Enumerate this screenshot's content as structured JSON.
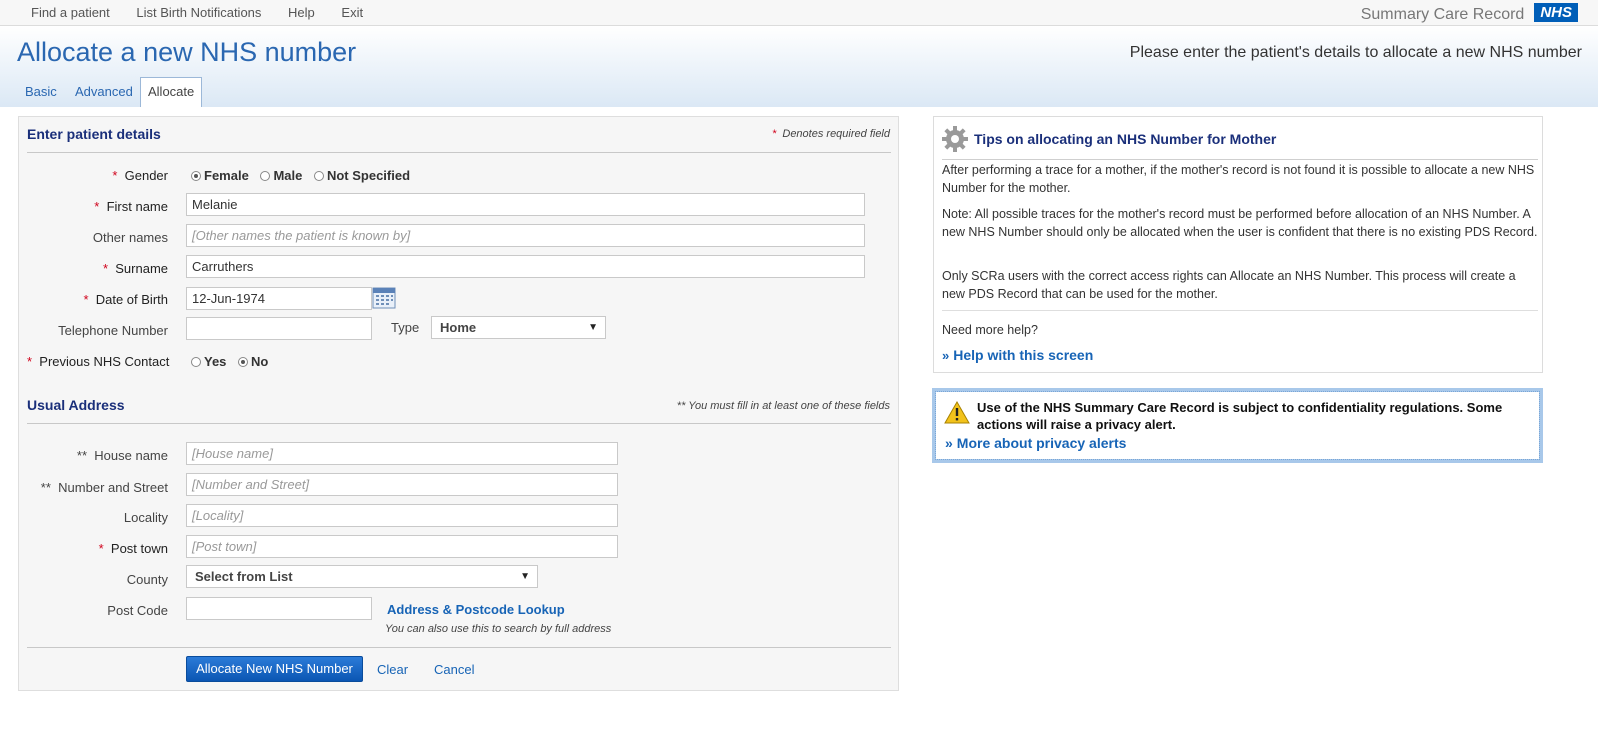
{
  "topnav": {
    "items": [
      "Find a patient",
      "List Birth Notifications",
      "Help",
      "Exit"
    ],
    "brand": "Summary Care Record",
    "logo": "NHS"
  },
  "header": {
    "title": "Allocate a new NHS number",
    "subtitle": "Please enter the patient's details to allocate a new NHS number",
    "tabs": [
      "Basic",
      "Advanced",
      "Allocate"
    ],
    "active_tab": "Allocate"
  },
  "form": {
    "section_title": "Enter patient details",
    "required_note": "Denotes required field",
    "required_mark": "*",
    "gender": {
      "label": "Gender",
      "options": [
        "Female",
        "Male",
        "Not Specified"
      ],
      "selected": "Female"
    },
    "first_name": {
      "label": "First name",
      "value": "Melanie"
    },
    "other_names": {
      "label": "Other names",
      "placeholder": "[Other names the patient is known by]"
    },
    "surname": {
      "label": "Surname",
      "value": "Carruthers"
    },
    "dob": {
      "label": "Date of Birth",
      "value": "12-Jun-1974"
    },
    "telephone": {
      "label": "Telephone Number",
      "value": "",
      "type_label": "Type",
      "type_value": "Home"
    },
    "prev_contact": {
      "label": "Previous NHS Contact",
      "options": [
        "Yes",
        "No"
      ],
      "selected": "No"
    },
    "address_title": "Usual Address",
    "address_note": "** You must fill in at least one of these fields",
    "double_mark": "**",
    "house_name": {
      "label": "House name",
      "placeholder": "[House name]"
    },
    "street": {
      "label": "Number and Street",
      "placeholder": "[Number and Street]"
    },
    "locality": {
      "label": "Locality",
      "placeholder": "[Locality]"
    },
    "post_town": {
      "label": "Post town",
      "placeholder": "[Post town]"
    },
    "county": {
      "label": "County",
      "value": "Select from List"
    },
    "post_code": {
      "label": "Post Code",
      "value": "",
      "lookup_link": "Address & Postcode Lookup",
      "lookup_hint": "You can also use this to search by full address"
    },
    "actions": {
      "allocate": "Allocate New NHS Number",
      "clear": "Clear",
      "cancel": "Cancel"
    }
  },
  "tips": {
    "title": "Tips on allocating an NHS Number for Mother",
    "p1": "After performing a trace for a mother, if the mother's record is not found it is possible to allocate a new NHS Number for the mother.",
    "p2": "Note: All possible traces for the mother's record must be performed before allocation of an NHS Number. A new NHS Number should only be allocated when the user is confident that there is no existing PDS Record.",
    "p3": "Only SCRa users with the correct access rights can Allocate an NHS Number. This process will create a new PDS Record that can be used for the mother.",
    "help_prompt": "Need more help?",
    "help_link": "Help with this screen"
  },
  "privacy": {
    "text": "Use of the NHS Summary Care Record is subject to confidentiality regulations. Some actions will raise a privacy alert.",
    "link": "More about privacy alerts"
  },
  "icons": [
    "gear-icon",
    "warning-icon",
    "calendar-icon",
    "double-chevron-icon",
    "chevron-down-icon"
  ],
  "colors": {
    "accent": "#2a67b1",
    "link": "#1764b6",
    "required": "#d0021b",
    "button": "#0b56b3",
    "heading": "#1a2f7a"
  }
}
